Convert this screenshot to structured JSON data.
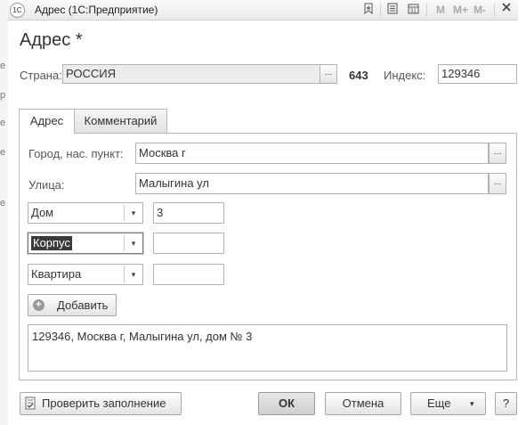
{
  "background": {
    "fragments": [
      "е",
      "р",
      "е",
      "е",
      "е"
    ]
  },
  "window": {
    "app_logo": "1С",
    "title": "Адрес  (1С:Предприятие)",
    "toolbar": {
      "m": "M",
      "m_plus": "M+",
      "m_minus": "M-"
    }
  },
  "form": {
    "title": "Адрес *",
    "country": {
      "label": "Страна:",
      "value": "РОССИЯ",
      "code": "643"
    },
    "index": {
      "label": "Индекс:",
      "value": "129346"
    },
    "tabs": [
      {
        "label": "Адрес",
        "active": true
      },
      {
        "label": "Комментарий",
        "active": false
      }
    ],
    "city": {
      "label": "Город, нас. пункт:",
      "value": "Москва г"
    },
    "street": {
      "label": "Улица:",
      "value": "Малыгина ул"
    },
    "building_rows": [
      {
        "type": "Дом",
        "value": "3"
      },
      {
        "type": "Корпус",
        "value": ""
      },
      {
        "type": "Квартира",
        "value": ""
      }
    ],
    "add_button": "Добавить",
    "address_text": "129346, Москва г, Малыгина ул, дом № 3",
    "select_button": "...",
    "dropdown_arrow": "▾"
  },
  "footer": {
    "check": "Проверить заполнение",
    "ok": "ОК",
    "cancel": "Отмена",
    "more": "Еще",
    "help": "?"
  }
}
